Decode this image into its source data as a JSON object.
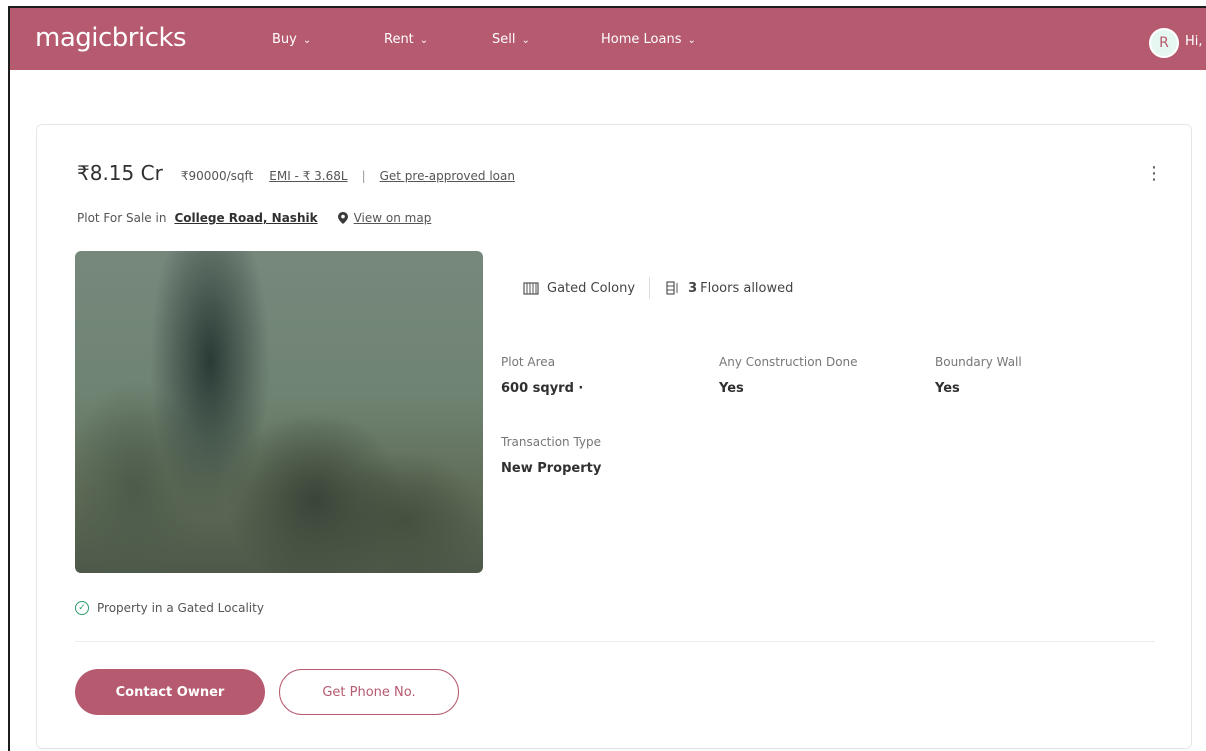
{
  "header": {
    "logo": "magicbricks",
    "nav": [
      {
        "label": "Buy"
      },
      {
        "label": "Rent"
      },
      {
        "label": "Sell"
      },
      {
        "label": "Home Loans"
      }
    ],
    "avatar_initial": "R",
    "greeting": "Hi,"
  },
  "listing": {
    "price": "₹8.15 Cr",
    "price_per_sqft": "₹90000/sqft",
    "emi": "EMI - ₹ 3.68L",
    "separator": "|",
    "loan_link": "Get pre-approved loan",
    "menu_icon": "kebab-icon",
    "type_prefix": "Plot For Sale in",
    "locality": "College Road, Nashik",
    "view_map": "View on map",
    "features": [
      {
        "icon": "gated-colony-icon",
        "label": "Gated Colony"
      },
      {
        "icon": "floors-icon",
        "strong": "3",
        "label": "Floors allowed"
      }
    ],
    "attributes": [
      {
        "label": "Plot Area",
        "value": "600 sqyrd ·"
      },
      {
        "label": "Any Construction Done",
        "value": "Yes"
      },
      {
        "label": "Boundary Wall",
        "value": "Yes"
      },
      {
        "label": "Transaction Type",
        "value": "New Property"
      }
    ],
    "highlight": "Property in a Gated Locality"
  },
  "actions": {
    "contact_owner": "Contact Owner",
    "get_phone": "Get Phone No."
  },
  "colors": {
    "brand": "#b65a6f",
    "check_green": "#2e9e6b"
  }
}
